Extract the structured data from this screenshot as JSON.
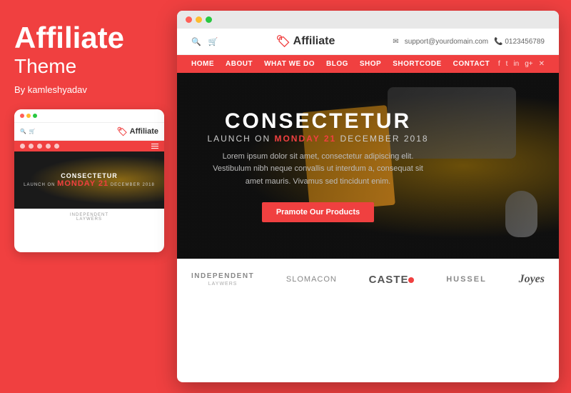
{
  "background_color": "#f04040",
  "left": {
    "title": "Affiliate",
    "subtitle": "Theme",
    "author": "By kamleshyadav"
  },
  "mobile": {
    "dots": [
      "#f04040",
      "#f5a623",
      "#7ed321"
    ],
    "logo": "Affiliate",
    "hero_title": "CONSECTETUR",
    "hero_launch": "LAUNCH ON",
    "hero_highlight": "MONDAY 21",
    "hero_date": "DECEMBER 2018",
    "bottom_line1": "INDEPENDENT",
    "bottom_line2": "LAYWERS"
  },
  "browser": {
    "dots": [
      "#ff5f57",
      "#febc2e",
      "#28c840"
    ],
    "header": {
      "search_icon": "🔍",
      "cart_icon": "🛒",
      "logo": "Affiliate",
      "email": "support@yourdomain.com",
      "phone": "📞 0123456789"
    },
    "nav": {
      "links": [
        "HOME",
        "ABOUT",
        "WHAT WE DO",
        "BLOG",
        "SHOP",
        "SHORTCODE",
        "CONTACT"
      ],
      "social": [
        "f",
        "t",
        "in",
        "g+",
        "✕"
      ]
    },
    "hero": {
      "title": "CONSECTETUR",
      "launch_pre": "LAUNCH ON",
      "launch_highlight": "MONDAY 21",
      "launch_post": "DECEMBER 2018",
      "description": "Lorem ipsum dolor sit amet, consectetur adipiscing elit. Vestibulum nibh neque convallis ut interdum a, consequat sit amet mauris. Vivamus sed tincidunt enim.",
      "cta": "Pramote Our Products"
    },
    "brands": [
      {
        "name": "INDEPENDENT",
        "sub": "LAYWERS",
        "type": "stacked"
      },
      {
        "name": "SLOMACON",
        "type": "single"
      },
      {
        "name": "CASTED",
        "type": "dot"
      },
      {
        "name": "HUSSEL",
        "type": "single"
      },
      {
        "name": "Joyes",
        "type": "script"
      }
    ]
  }
}
